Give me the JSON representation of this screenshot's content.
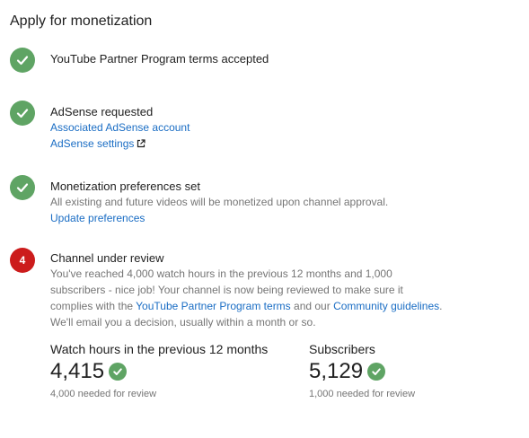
{
  "page": {
    "title": "Apply for monetization"
  },
  "steps": [
    {
      "status": "done",
      "heading": "YouTube Partner Program terms accepted"
    },
    {
      "status": "done",
      "heading": "AdSense requested",
      "links": [
        "Associated AdSense account",
        "AdSense settings"
      ]
    },
    {
      "status": "done",
      "heading": "Monetization preferences set",
      "description": "All existing and future videos will be monetized upon channel approval.",
      "links": [
        "Update preferences"
      ]
    },
    {
      "status": "current",
      "number": "4",
      "heading": "Channel under review",
      "description_part1": "You've reached 4,000 watch hours in the previous 12 months and 1,000 subscribers - nice job! Your channel is now being reviewed to make sure it complies with the ",
      "link1": "YouTube Partner Program terms",
      "description_part2": " and our ",
      "link2": "Community guidelines",
      "description_part3": ".",
      "description_line2": "We'll email you a decision, usually within a month or so."
    }
  ],
  "stats": {
    "watch_hours": {
      "label": "Watch hours in the previous 12 months",
      "value": "4,415",
      "note": "4,000 needed for review"
    },
    "subscribers": {
      "label": "Subscribers",
      "value": "5,129",
      "note": "1,000 needed for review"
    }
  },
  "colors": {
    "check_green": "#5fa464",
    "current_red": "#cc1c1c",
    "link_blue": "#1a6dc4",
    "secondary_text": "#757575"
  },
  "icons": {
    "done": "check-circle-icon",
    "external": "open-in-new-icon"
  }
}
